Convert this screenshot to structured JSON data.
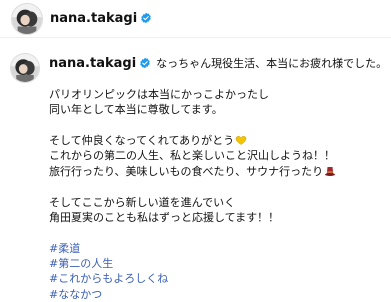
{
  "post": {
    "username": "nana.takagi",
    "caption_title": "なっちゃん現役生活、本当にお疲れ様でした。",
    "lines": [
      "パリオリンピックは本当にかっこよかったし",
      "同い年として本当に尊敬してます。",
      "",
      "そして仲良くなってくれてありがとう",
      "これからの第二の人生、私と楽しいこと沢山しようね！！",
      "旅行行ったり、美味しいもの食べたり、サウナ行ったり",
      "",
      "そしてここから新しい道を進んでいく",
      "角田夏実のことも私はずっと応援してます！！"
    ],
    "hashtags": [
      "#柔道",
      "#第二の人生",
      "#これからもよろしくね",
      "#ななかつ"
    ]
  },
  "icons": {
    "verified": "verified-badge-icon",
    "heart": "yellow-heart-icon",
    "hat": "red-hat-icon"
  },
  "colors": {
    "verified_blue": "#1d9bf0",
    "hashtag_blue": "#3b5fb8",
    "heart_yellow": "#f5c400",
    "hat_red": "#a6262b"
  }
}
